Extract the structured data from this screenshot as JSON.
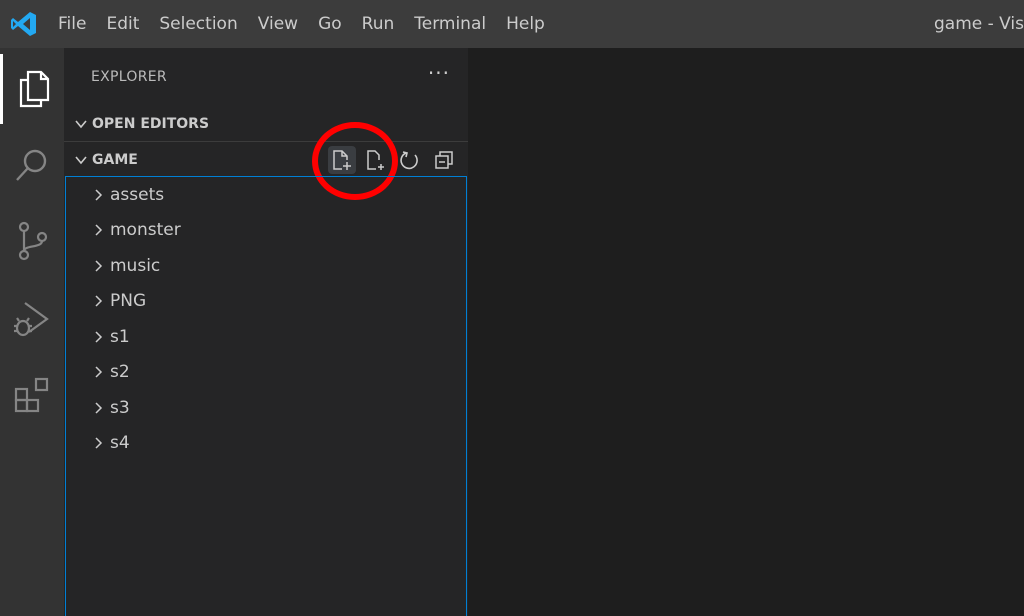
{
  "titlebar": {
    "menu": [
      "File",
      "Edit",
      "Selection",
      "View",
      "Go",
      "Run",
      "Terminal",
      "Help"
    ],
    "window_title": "game - Visu"
  },
  "activitybar": {
    "items": [
      "files-icon",
      "search-icon",
      "source-control-icon",
      "run-debug-icon",
      "extensions-icon"
    ]
  },
  "sidebar": {
    "title": "EXPLORER",
    "more": "···",
    "sections": {
      "open_editors": "OPEN EDITORS",
      "workspace": "GAME"
    },
    "tree": [
      "assets",
      "monster",
      "music",
      "PNG",
      "s1",
      "s2",
      "s3",
      "s4"
    ]
  },
  "colors": {
    "titlebar": "#3c3c3c",
    "activitybar": "#333333",
    "sidebar": "#252526",
    "editor": "#1e1e1e",
    "focus_border": "#007fd4",
    "annotation_red": "#ff0000",
    "vscode_blue": "#23a9f2"
  }
}
